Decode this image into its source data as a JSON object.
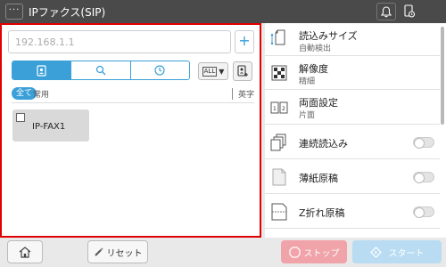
{
  "header": {
    "title": "IPファクス(SIP)",
    "menu_label": "···"
  },
  "address": {
    "placeholder": "192.168.1.1",
    "add_label": "+"
  },
  "filter": {
    "all_dropdown_badge": "ALL",
    "chip_all": "全て",
    "chip_common": "常用",
    "chip_alpha": "英字"
  },
  "destinations": [
    {
      "label": "IP-FAX1"
    }
  ],
  "settings": [
    {
      "name": "読込みサイズ",
      "value": "自動検出",
      "icon": "scan-size-icon"
    },
    {
      "name": "解像度",
      "value": "精細",
      "icon": "resolution-icon"
    },
    {
      "name": "両面設定",
      "value": "片面",
      "icon": "duplex-icon"
    },
    {
      "name": "連続読込み",
      "icon": "continuous-scan-icon",
      "toggle": "off"
    },
    {
      "name": "薄紙原稿",
      "icon": "thin-paper-icon",
      "toggle": "off"
    },
    {
      "name": "Z折れ原稿",
      "icon": "z-fold-icon",
      "toggle": "off"
    }
  ],
  "bottom": {
    "reset_label": "リセット",
    "stop_label": "ストップ",
    "start_label": "スタート"
  },
  "colors": {
    "accent": "#3ba0d8",
    "highlight_border": "#e00000",
    "stop": "#f0a3a9",
    "start": "#b9dcf2"
  }
}
